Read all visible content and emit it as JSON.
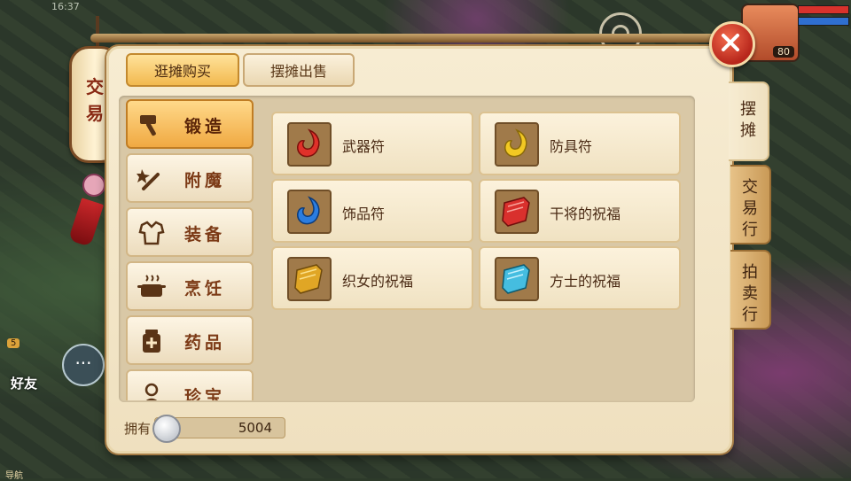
{
  "hud": {
    "time": "16:37",
    "player_level": "80",
    "friends_count": "5",
    "friends_label": "好友",
    "bottom_left_text": "导航"
  },
  "lantern": {
    "title_line1": "交",
    "title_line2": "易"
  },
  "tabs": {
    "browse_buy": "逛摊购买",
    "sell": "摆摊出售"
  },
  "categories": [
    {
      "label": "锻造",
      "icon": "hammer-icon",
      "active": true
    },
    {
      "label": "附魔",
      "icon": "magic-wand-icon",
      "active": false
    },
    {
      "label": "装备",
      "icon": "armor-icon",
      "active": false
    },
    {
      "label": "烹饪",
      "icon": "cooking-pot-icon",
      "active": false
    },
    {
      "label": "药品",
      "icon": "medicine-icon",
      "active": false
    },
    {
      "label": "珍宝",
      "icon": "treasure-icon",
      "active": false
    }
  ],
  "items": [
    {
      "name": "武器符",
      "icon": "red-talisman-icon",
      "color": "#e0312a"
    },
    {
      "name": "防具符",
      "icon": "yellow-talisman-icon",
      "color": "#f2c823"
    },
    {
      "name": "饰品符",
      "icon": "blue-talisman-icon",
      "color": "#2b7de0"
    },
    {
      "name": "干将的祝福",
      "icon": "red-scroll-icon",
      "color": "#d9302d"
    },
    {
      "name": "织女的祝福",
      "icon": "gold-scroll-icon",
      "color": "#e0a625"
    },
    {
      "name": "方士的祝福",
      "icon": "cyan-scroll-icon",
      "color": "#45bde0"
    }
  ],
  "currency": {
    "label": "拥有",
    "amount": "5004",
    "icon": "silver-coin-icon"
  },
  "side_tabs": {
    "stall": "摆摊",
    "exchange": "交易行",
    "auction": "拍卖行"
  }
}
